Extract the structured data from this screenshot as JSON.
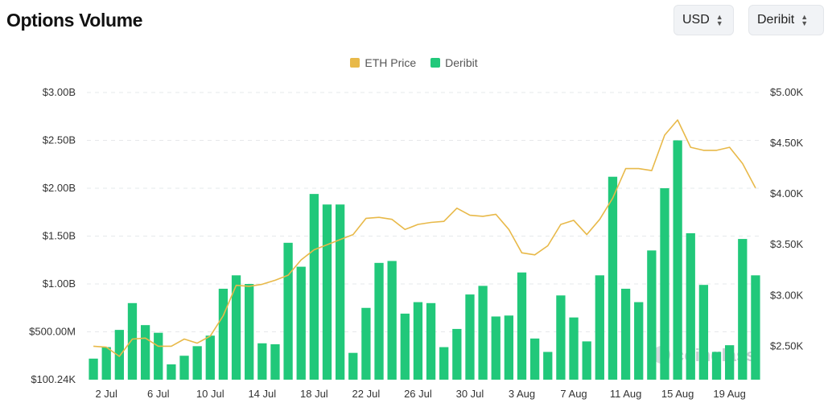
{
  "header": {
    "title": "Options Volume",
    "currency_select": "USD",
    "exchange_select": "Deribit"
  },
  "legend": [
    {
      "label": "ETH Price",
      "color": "#e8b949"
    },
    {
      "label": "Deribit",
      "color": "#21c87a"
    }
  ],
  "watermark": "coinglass",
  "chart_data": {
    "type": "bar",
    "title": "Options Volume",
    "left_axis": {
      "tick_labels": [
        "$100.24K",
        "$500.00M",
        "$1.00B",
        "$1.50B",
        "$2.00B",
        "$2.50B",
        "$3.00B"
      ],
      "tick_values": [
        0.0001,
        0.5,
        1.0,
        1.5,
        2.0,
        2.5,
        3.0
      ],
      "range": [
        0.0,
        3.0
      ]
    },
    "right_axis": {
      "tick_labels": [
        "$2.50K",
        "$3.00K",
        "$3.50K",
        "$4.00K",
        "$4.50K",
        "$5.00K"
      ],
      "tick_values": [
        2500,
        3000,
        3500,
        4000,
        4500,
        5000
      ],
      "range": [
        2170,
        5000
      ]
    },
    "x_tick_labels": [
      "2 Jul",
      "6 Jul",
      "10 Jul",
      "14 Jul",
      "18 Jul",
      "22 Jul",
      "26 Jul",
      "30 Jul",
      "3 Aug",
      "7 Aug",
      "11 Aug",
      "15 Aug",
      "19 Aug"
    ],
    "x_tick_every": 4,
    "x_tick_start_index": 1,
    "series": [
      {
        "name": "Deribit",
        "type": "bar",
        "axis": "left",
        "color": "#21c87a",
        "values": [
          0.22,
          0.34,
          0.52,
          0.8,
          0.57,
          0.49,
          0.16,
          0.25,
          0.35,
          0.46,
          0.95,
          1.09,
          1.0,
          0.38,
          0.37,
          1.43,
          1.18,
          1.94,
          1.83,
          1.83,
          0.28,
          0.75,
          1.22,
          1.24,
          0.69,
          0.81,
          0.8,
          0.34,
          0.53,
          0.89,
          0.98,
          0.66,
          0.67,
          1.12,
          0.43,
          0.29,
          0.88,
          0.65,
          0.4,
          1.09,
          2.12,
          0.95,
          0.81,
          1.35,
          2.0,
          2.5,
          1.53,
          0.99,
          0.29,
          0.36,
          1.47,
          1.09
        ]
      },
      {
        "name": "ETH Price",
        "type": "line",
        "axis": "right",
        "color": "#e8b949",
        "values": [
          2500,
          2490,
          2400,
          2570,
          2580,
          2500,
          2500,
          2570,
          2530,
          2600,
          2800,
          3100,
          3090,
          3110,
          3150,
          3200,
          3350,
          3450,
          3500,
          3550,
          3600,
          3760,
          3770,
          3750,
          3650,
          3700,
          3720,
          3730,
          3860,
          3790,
          3780,
          3800,
          3650,
          3420,
          3400,
          3490,
          3700,
          3740,
          3600,
          3750,
          3960,
          4250,
          4250,
          4230,
          4580,
          4730,
          4460,
          4430,
          4430,
          4460,
          4300,
          4060
        ]
      }
    ],
    "grid": true,
    "legend_position": "top-center"
  }
}
